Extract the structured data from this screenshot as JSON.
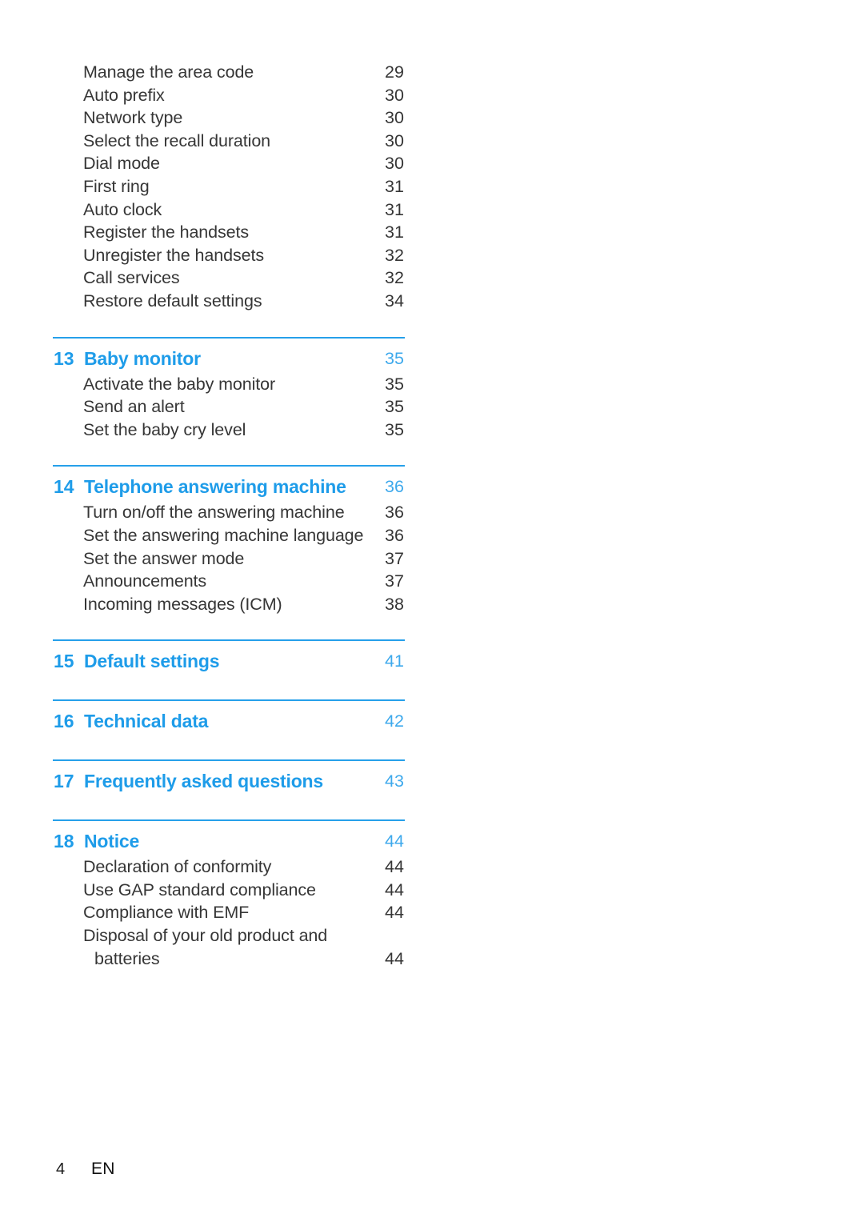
{
  "document": {
    "type": "table-of-contents",
    "footer": {
      "page_number": "4",
      "language": "EN"
    },
    "colors": {
      "heading_blue": "#1E9CE9",
      "rule_blue": "#26A0EA",
      "heading_page_blue": "#3EA9EC",
      "body_text": "#363636",
      "background": "#FFFFFF"
    }
  },
  "continued_entries": [
    {
      "label": "Manage the area code",
      "page": "29"
    },
    {
      "label": "Auto prefix",
      "page": "30"
    },
    {
      "label": "Network type",
      "page": "30"
    },
    {
      "label": "Select the recall duration",
      "page": "30"
    },
    {
      "label": "Dial mode",
      "page": "30"
    },
    {
      "label": "First ring",
      "page": "31"
    },
    {
      "label": "Auto clock",
      "page": "31"
    },
    {
      "label": "Register the handsets",
      "page": "31"
    },
    {
      "label": "Unregister the handsets",
      "page": "32"
    },
    {
      "label": "Call services",
      "page": "32"
    },
    {
      "label": "Restore default settings",
      "page": "34"
    }
  ],
  "sections": [
    {
      "number": "13",
      "title": "Baby monitor",
      "page": "35",
      "entries": [
        {
          "label": "Activate the baby monitor",
          "page": "35"
        },
        {
          "label": "Send an alert",
          "page": "35"
        },
        {
          "label": "Set the baby cry level",
          "page": "35"
        }
      ]
    },
    {
      "number": "14",
      "title": "Telephone answering machine",
      "page": "36",
      "entries": [
        {
          "label": "Turn on/off the answering machine",
          "page": "36"
        },
        {
          "label": "Set the answering machine language",
          "page": "36"
        },
        {
          "label": "Set the answer mode",
          "page": "37"
        },
        {
          "label": "Announcements",
          "page": "37"
        },
        {
          "label": "Incoming messages (ICM)",
          "page": "38"
        }
      ]
    },
    {
      "number": "15",
      "title": "Default settings",
      "page": "41",
      "entries": []
    },
    {
      "number": "16",
      "title": "Technical data",
      "page": "42",
      "entries": []
    },
    {
      "number": "17",
      "title": "Frequently asked questions",
      "page": "43",
      "entries": []
    },
    {
      "number": "18",
      "title": "Notice",
      "page": "44",
      "entries": [
        {
          "label": "Declaration of conformity",
          "page": "44"
        },
        {
          "label": "Use GAP standard compliance",
          "page": "44"
        },
        {
          "label": "Compliance with EMF",
          "page": "44"
        },
        {
          "label": "Disposal of your old product and",
          "page": ""
        },
        {
          "label": "batteries",
          "page": "44",
          "continuation": true
        }
      ]
    }
  ]
}
